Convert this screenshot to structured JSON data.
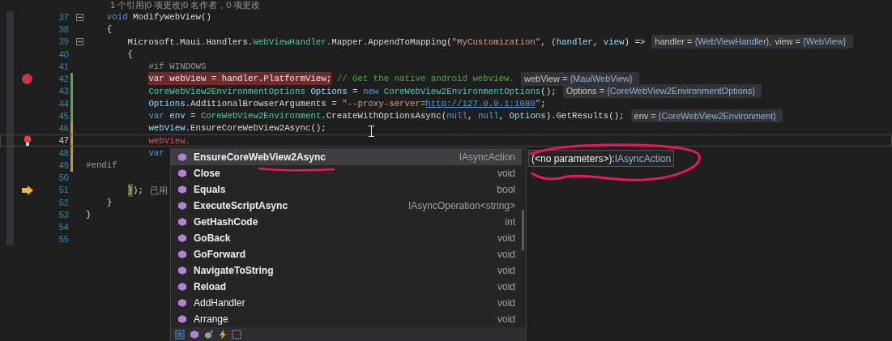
{
  "codelens": "1 个引用|0 项更改|0 名作者，0 项更改",
  "lines": [
    {
      "number": "37",
      "current": false,
      "toggle": {
        "expanded": true
      },
      "tokens": [
        {
          "kind": "kw",
          "text": "    void"
        },
        {
          "kind": "plain",
          "text": " ModifyWebView()"
        }
      ]
    },
    {
      "number": "38",
      "current": false,
      "tokens": [
        {
          "kind": "plain",
          "text": "    {"
        }
      ]
    },
    {
      "number": "39",
      "current": false,
      "toggle": {
        "expanded": true
      },
      "tokens": [
        {
          "kind": "plain",
          "text": "        Microsoft.Maui.Handlers."
        },
        {
          "kind": "type",
          "text": "WebViewHandler"
        },
        {
          "kind": "plain",
          "text": ".Mapper.AppendToMapping("
        },
        {
          "kind": "str",
          "text": "\"MyCustomization\""
        },
        {
          "kind": "plain",
          "text": ", ("
        },
        {
          "kind": "id",
          "text": "handler"
        },
        {
          "kind": "plain",
          "text": ", "
        },
        {
          "kind": "id",
          "text": "view"
        },
        {
          "kind": "plain",
          "text": ") =>"
        }
      ],
      "hints": [
        {
          "name": "handler = ",
          "value": "{WebViewHandler},"
        },
        {
          "name": "view = ",
          "value": "{WebView}"
        }
      ]
    },
    {
      "number": "40",
      "current": false,
      "tokens": [
        {
          "kind": "plain",
          "text": "        {"
        }
      ]
    },
    {
      "number": "41",
      "current": false,
      "tokens": [
        {
          "kind": "pre",
          "text": "            #if WINDOWS"
        }
      ]
    },
    {
      "number": "42",
      "gutter": {
        "kind": "breakpoint"
      },
      "color": "#57a64a",
      "current": false,
      "tokens": [
        {
          "kind": "bp",
          "text": "            var webView = handler.PlatformView;"
        },
        {
          "kind": "comment",
          "text": " // Get the native android webview."
        }
      ],
      "hints": [
        {
          "name": "webView = ",
          "value": "{MauiWebView}"
        }
      ]
    },
    {
      "number": "43",
      "color": "#57a64a",
      "current": false,
      "tokens": [
        {
          "kind": "type",
          "text": "            CoreWebView2EnvironmentOptions"
        },
        {
          "kind": "id",
          "text": " Options"
        },
        {
          "kind": "plain",
          "text": " = "
        },
        {
          "kind": "kw",
          "text": "new"
        },
        {
          "kind": "type",
          "text": " CoreWebView2EnvironmentOptions"
        },
        {
          "kind": "plain",
          "text": "();"
        }
      ],
      "hints": [
        {
          "name": "Options = ",
          "value": "{CoreWebView2EnvironmentOptions}"
        }
      ]
    },
    {
      "number": "44",
      "color": "#57a64a",
      "current": false,
      "tokens": [
        {
          "kind": "id",
          "text": "            Options"
        },
        {
          "kind": "plain",
          "text": ".AdditionalBrowserArguments = "
        },
        {
          "kind": "str",
          "text": "\"--proxy-server="
        },
        {
          "kind": "link",
          "text": "http://127.0.0.1:1080"
        },
        {
          "kind": "str",
          "text": "\""
        },
        {
          "kind": "plain",
          "text": ";"
        }
      ]
    },
    {
      "number": "45",
      "color": "#57a64a",
      "current": false,
      "tokens": [
        {
          "kind": "kw",
          "text": "            var"
        },
        {
          "kind": "id",
          "text": " env"
        },
        {
          "kind": "plain",
          "text": " = "
        },
        {
          "kind": "type",
          "text": "CoreWebView2Environment"
        },
        {
          "kind": "plain",
          "text": ".CreateWithOptionsAsync("
        },
        {
          "kind": "kw",
          "text": "null"
        },
        {
          "kind": "plain",
          "text": ", "
        },
        {
          "kind": "kw",
          "text": "null"
        },
        {
          "kind": "plain",
          "text": ", "
        },
        {
          "kind": "id",
          "text": "Options"
        },
        {
          "kind": "plain",
          "text": ").GetResults();"
        }
      ],
      "hints": [
        {
          "name": "env = ",
          "value": "{CoreWebView2Environment}"
        }
      ]
    },
    {
      "number": "46",
      "color": "#b5a22a",
      "current": false,
      "tokens": [
        {
          "kind": "id",
          "text": "            webView"
        },
        {
          "kind": "plain",
          "text": ".EnsureCoreWebView2Async();"
        }
      ]
    },
    {
      "number": "47",
      "gutter": {
        "kind": "lightbulb"
      },
      "color": "#b5a22a",
      "current": true,
      "tokens": [
        {
          "kind": "err",
          "text": "            webView."
        }
      ]
    },
    {
      "number": "48",
      "color": "#b5a22a",
      "current": false,
      "tokens": [
        {
          "kind": "kw",
          "text": "            var"
        }
      ]
    },
    {
      "number": "49",
      "color": "#b5a22a",
      "current": false,
      "tokens": [
        {
          "kind": "pre",
          "text": "#endif"
        }
      ]
    },
    {
      "number": "50",
      "current": false
    },
    {
      "number": "51",
      "gutter": {
        "kind": "arrow"
      },
      "current": false,
      "tokens": [
        {
          "kind": "brace",
          "text": "        }"
        },
        {
          "kind": "plain",
          "text": ");"
        },
        {
          "kind": "note",
          "text": "已用"
        }
      ]
    },
    {
      "number": "52",
      "current": false,
      "tokens": [
        {
          "kind": "plain",
          "text": "    }"
        }
      ]
    },
    {
      "number": "53",
      "current": false,
      "tokens": [
        {
          "kind": "plain",
          "text": "}"
        }
      ]
    },
    {
      "number": "54",
      "current": false
    },
    {
      "number": "55",
      "current": false
    }
  ],
  "completion": {
    "items": [
      {
        "name": "EnsureCoreWebView2Async",
        "type": "IAsyncAction",
        "bold": true,
        "selected": true
      },
      {
        "name": "Close",
        "type": "void",
        "bold": true,
        "selected": false
      },
      {
        "name": "Equals",
        "type": "bool",
        "bold": true,
        "selected": false
      },
      {
        "name": "ExecuteScriptAsync",
        "type": "IAsyncOperation<string>",
        "bold": true,
        "selected": false
      },
      {
        "name": "GetHashCode",
        "type": "int",
        "bold": true,
        "selected": false
      },
      {
        "name": "GoBack",
        "type": "void",
        "bold": true,
        "selected": false
      },
      {
        "name": "GoForward",
        "type": "void",
        "bold": true,
        "selected": false
      },
      {
        "name": "NavigateToString",
        "type": "void",
        "bold": true,
        "selected": false
      },
      {
        "name": "Reload",
        "type": "void",
        "bold": true,
        "selected": false
      },
      {
        "name": "AddHandler",
        "type": "void",
        "bold": false,
        "selected": false
      },
      {
        "name": "Arrange",
        "type": "void",
        "bold": false,
        "selected": false
      }
    ],
    "filters": [
      {
        "kind": "list"
      },
      {
        "kind": "method"
      },
      {
        "kind": "extension"
      },
      {
        "kind": "event"
      },
      {
        "kind": "grid"
      }
    ]
  },
  "tooltip": {
    "signature": "(<no parameters>):",
    "return_type": "IAsyncAction"
  }
}
